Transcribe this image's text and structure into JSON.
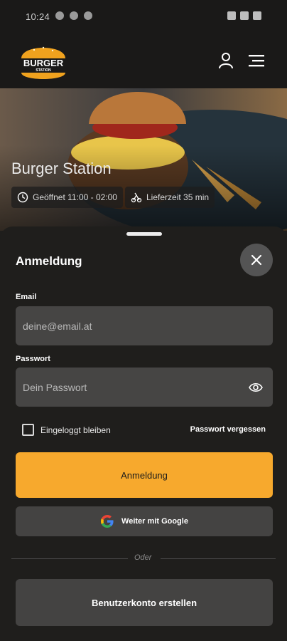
{
  "status_bar": {
    "time": "10:24"
  },
  "brand": {
    "logo_top": "BURGER",
    "logo_bottom": "STATION"
  },
  "hero": {
    "title": "Burger Station",
    "opening": "Geöffnet 11:00 - 02:00",
    "delivery": "Lieferzeit 35 min"
  },
  "login": {
    "title": "Anmeldung",
    "email_label": "Email",
    "email_placeholder": "deine@email.at",
    "password_label": "Passwort",
    "password_placeholder": "Dein Passwort",
    "remember_label": "Eingeloggt bleiben",
    "forgot_label": "Passwort vergessen",
    "submit_label": "Anmeldung",
    "google_label": "Weiter mit Google",
    "divider_label": "Oder",
    "create_label": "Benutzerkonto erstellen"
  },
  "colors": {
    "accent": "#f7a92d",
    "sheet_bg": "#1f1e1c",
    "input_bg": "#464544",
    "button_bg": "#444342"
  },
  "icons": [
    "user-icon",
    "menu-icon",
    "clock-icon",
    "delivery-icon",
    "close-icon",
    "eye-icon",
    "google-icon"
  ]
}
